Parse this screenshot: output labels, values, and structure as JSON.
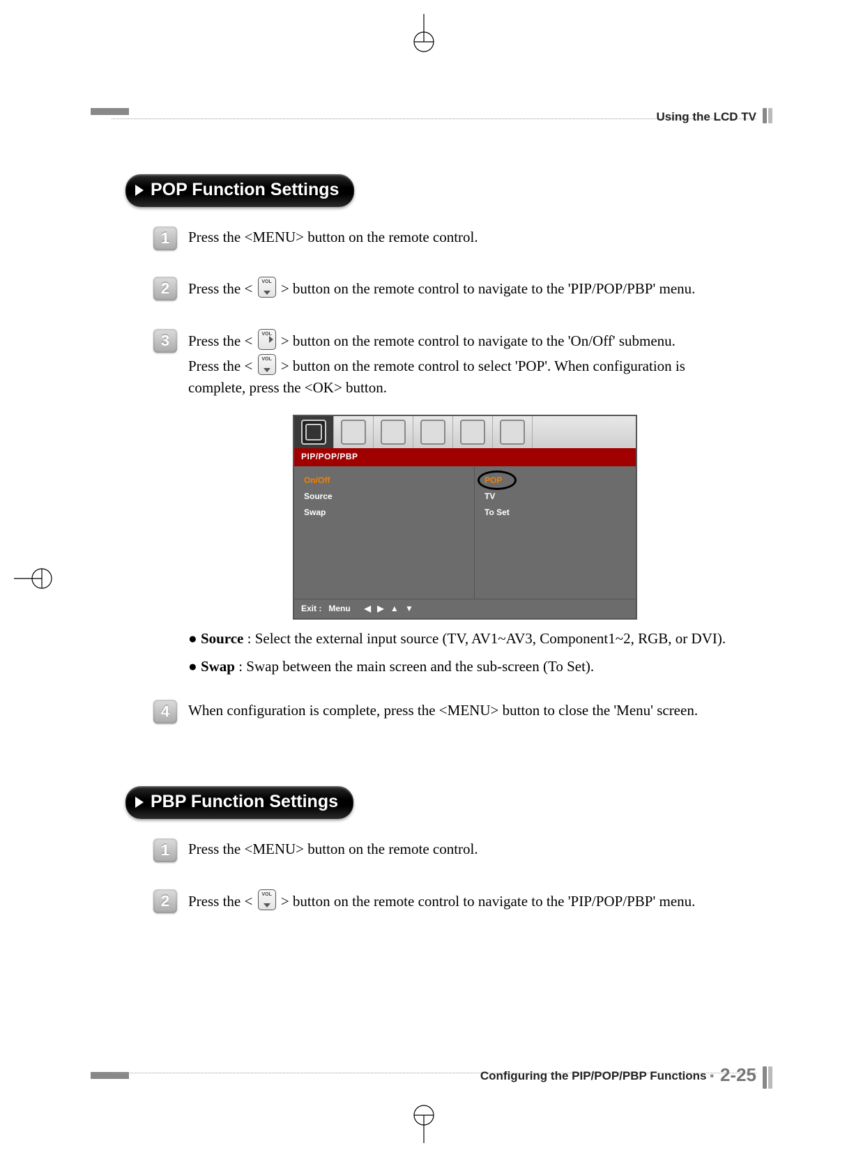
{
  "header": {
    "section": "Using the LCD TV"
  },
  "footer": {
    "topic": "Configuring the PIP/POP/PBP Functions",
    "page": "2-25"
  },
  "sections": [
    {
      "title": "POP Function Settings",
      "steps": [
        {
          "n": "1",
          "lines": [
            "Press the <MENU> button on the remote control."
          ]
        },
        {
          "n": "2",
          "lines_pre": "Press the < ",
          "icon": "vol-down",
          "lines_post": " > button on the remote control to navigate to the 'PIP/POP/PBP' menu."
        },
        {
          "n": "3",
          "line1_pre": "Press the < ",
          "line1_icon": "vol-right",
          "line1_post": " > button on the remote control to navigate to the 'On/Off' submenu.",
          "line2_pre": "Press the < ",
          "line2_icon": "vol-down",
          "line2_post": " > button on the remote control to select 'POP'. When configuration is complete, press the <OK> button.",
          "bullets": [
            {
              "label": "Source",
              "text": " : Select the external input source (TV, AV1~AV3, Component1~2, RGB, or DVI)."
            },
            {
              "label": "Swap",
              "text": " : Swap between the main screen and the sub-screen (To Set)."
            }
          ]
        },
        {
          "n": "4",
          "lines": [
            "When configuration is complete, press the <MENU> button to close the 'Menu' screen."
          ]
        }
      ]
    },
    {
      "title": "PBP Function Settings",
      "steps": [
        {
          "n": "1",
          "lines": [
            "Press the <MENU> button on the remote control."
          ]
        },
        {
          "n": "2",
          "lines_pre": "Press the < ",
          "icon": "vol-down",
          "lines_post": " > button on the remote control to navigate to the 'PIP/POP/PBP' menu."
        }
      ]
    }
  ],
  "osd": {
    "title": "PIP/POP/PBP",
    "left": [
      {
        "label": "On/Off",
        "selected": true
      },
      {
        "label": "Source",
        "selected": false
      },
      {
        "label": "Swap",
        "selected": false
      }
    ],
    "right": [
      {
        "label": "POP",
        "selected": true
      },
      {
        "label": "TV",
        "selected": false
      },
      {
        "label": "To Set",
        "selected": false
      }
    ],
    "statusExit": "Exit :",
    "statusMenu": "Menu",
    "statusArrows": "◀ ▶ ▲ ▼"
  }
}
